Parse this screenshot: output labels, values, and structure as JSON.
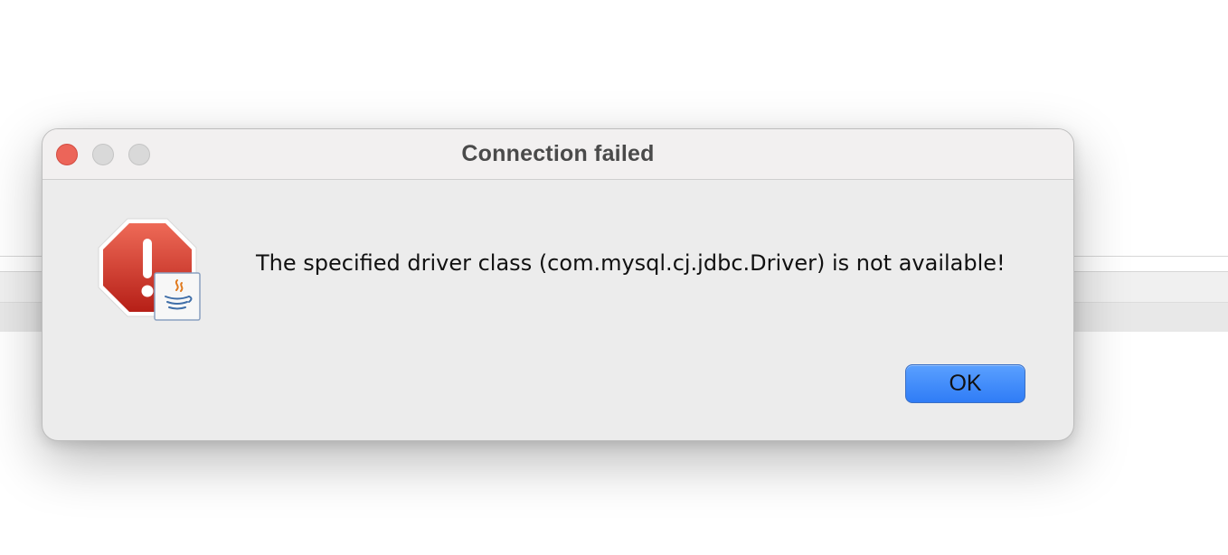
{
  "dialog": {
    "title": "Connection failed",
    "message": "The specified driver class (com.mysql.cj.jdbc.Driver) is not available!",
    "ok_label": "OK",
    "icon": "stop-alert-icon",
    "badge_icon": "java-icon"
  },
  "window_controls": {
    "close_color": "#ec6559",
    "min_color": "#d9d9d9",
    "max_color": "#d9d9d9"
  },
  "colors": {
    "accent": "#2f7cf6",
    "alert_red": "#c62b22"
  }
}
